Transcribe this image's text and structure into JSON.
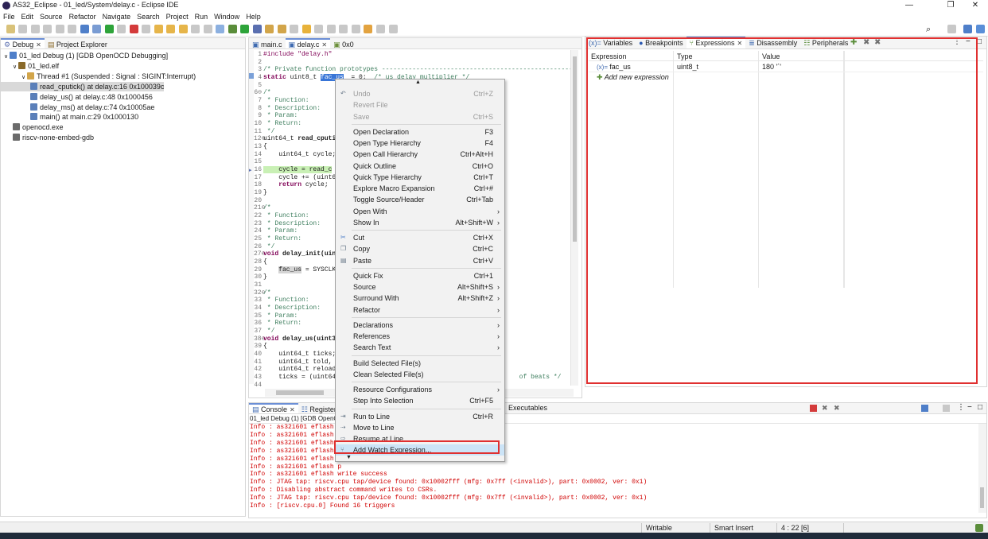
{
  "window": {
    "title": "AS32_Eclipse - 01_led/System/delay.c - Eclipse IDE",
    "minimize": "—",
    "maximize": "❐",
    "close": "✕"
  },
  "menubar": [
    "File",
    "Edit",
    "Source",
    "Refactor",
    "Navigate",
    "Search",
    "Project",
    "Run",
    "Window",
    "Help"
  ],
  "colors": {
    "accent": "#6b8fd6",
    "highlight_box": "#e03030",
    "console_text": "#d00000",
    "selection": "#cce4f7"
  },
  "debug_view": {
    "tabs": [
      "Debug",
      "Project Explorer"
    ],
    "items": [
      {
        "label": "01_led Debug (1) [GDB OpenOCD Debugging]",
        "icon": "launch-config-icon",
        "indent": 0
      },
      {
        "label": "01_led.elf",
        "icon": "elf-icon",
        "indent": 1
      },
      {
        "label": "Thread #1 (Suspended : Signal : SIGINT:Interrupt)",
        "icon": "thread-icon",
        "indent": 2
      },
      {
        "label": "read_cputick() at delay.c:16 0x100039c",
        "icon": "stack-frame-icon",
        "indent": 3,
        "selected": true
      },
      {
        "label": "delay_us() at delay.c:48 0x1000456",
        "icon": "stack-frame-icon",
        "indent": 3
      },
      {
        "label": "delay_ms() at delay.c:74 0x10005ae",
        "icon": "stack-frame-icon",
        "indent": 3
      },
      {
        "label": "main() at main.c:29 0x1000130",
        "icon": "stack-frame-icon",
        "indent": 3
      },
      {
        "label": "openocd.exe",
        "icon": "process-icon",
        "indent": 1
      },
      {
        "label": "riscv-none-embed-gdb",
        "icon": "process-icon",
        "indent": 1
      }
    ]
  },
  "editor": {
    "tabs": [
      "main.c",
      "delay.c",
      "0x0"
    ],
    "active_tab": "delay.c",
    "lines": [
      {
        "n": "1",
        "parts": [
          [
            "pp",
            "#include \"delay.h\""
          ]
        ]
      },
      {
        "n": "2",
        "parts": [
          [
            "",
            ""
          ]
        ]
      },
      {
        "n": "3",
        "parts": [
          [
            "cm",
            "/* Private function prototypes --------------------------------------------------*/"
          ]
        ]
      },
      {
        "n": "4",
        "parts": [
          [
            "kw",
            "static "
          ],
          [
            "",
            "uint8_t "
          ],
          [
            "sel",
            "fac_us"
          ],
          [
            "",
            "  = 0;  "
          ],
          [
            "cm",
            "/* us delay multiplier */"
          ]
        ]
      },
      {
        "n": "5",
        "parts": [
          [
            "",
            ""
          ]
        ]
      },
      {
        "n": "6⊖",
        "parts": [
          [
            "cm",
            "/*"
          ]
        ]
      },
      {
        "n": "7",
        "parts": [
          [
            "cm",
            " * Function:"
          ]
        ]
      },
      {
        "n": "8",
        "parts": [
          [
            "cm",
            " * Description:"
          ]
        ]
      },
      {
        "n": "9",
        "parts": [
          [
            "cm",
            " * Param:"
          ]
        ]
      },
      {
        "n": "10",
        "parts": [
          [
            "cm",
            " * Return:"
          ]
        ]
      },
      {
        "n": "11",
        "parts": [
          [
            "cm",
            " */"
          ]
        ]
      },
      {
        "n": "12⊖",
        "parts": [
          [
            "",
            "uint64_t "
          ],
          [
            "b",
            "read_cputi"
          ]
        ]
      },
      {
        "n": "13",
        "parts": [
          [
            "",
            "{"
          ]
        ]
      },
      {
        "n": "14",
        "parts": [
          [
            "",
            "    uint64_t cycle;"
          ]
        ]
      },
      {
        "n": "15",
        "parts": [
          [
            "",
            ""
          ]
        ]
      },
      {
        "n": "16",
        "parts": [
          [
            "cur",
            "    cycle = read_c"
          ]
        ]
      },
      {
        "n": "17",
        "parts": [
          [
            "",
            "    cycle += (uint6"
          ]
        ]
      },
      {
        "n": "18",
        "parts": [
          [
            "kw",
            "    return "
          ],
          [
            "",
            "cycle;"
          ]
        ]
      },
      {
        "n": "19",
        "parts": [
          [
            "",
            "}"
          ]
        ]
      },
      {
        "n": "20",
        "parts": [
          [
            "",
            ""
          ]
        ]
      },
      {
        "n": "21⊖",
        "parts": [
          [
            "cm",
            "/*"
          ]
        ]
      },
      {
        "n": "22",
        "parts": [
          [
            "cm",
            " * Function:"
          ]
        ]
      },
      {
        "n": "23",
        "parts": [
          [
            "cm",
            " * Description:"
          ]
        ]
      },
      {
        "n": "24",
        "parts": [
          [
            "cm",
            " * Param:"
          ]
        ]
      },
      {
        "n": "25",
        "parts": [
          [
            "cm",
            " * Return:"
          ]
        ]
      },
      {
        "n": "26",
        "parts": [
          [
            "cm",
            " */"
          ]
        ]
      },
      {
        "n": "27⊖",
        "parts": [
          [
            "kw",
            "void "
          ],
          [
            "b",
            "delay_init(uin"
          ]
        ]
      },
      {
        "n": "28",
        "parts": [
          [
            "",
            "{"
          ]
        ]
      },
      {
        "n": "29",
        "parts": [
          [
            "",
            "    "
          ],
          [
            "hl",
            "fac_us"
          ],
          [
            "",
            " = SYSCLK"
          ]
        ]
      },
      {
        "n": "30",
        "parts": [
          [
            "",
            "}"
          ]
        ]
      },
      {
        "n": "31",
        "parts": [
          [
            "",
            ""
          ]
        ]
      },
      {
        "n": "32⊖",
        "parts": [
          [
            "cm",
            "/*"
          ]
        ]
      },
      {
        "n": "33",
        "parts": [
          [
            "cm",
            " * Function:"
          ]
        ]
      },
      {
        "n": "34",
        "parts": [
          [
            "cm",
            " * Description:"
          ]
        ]
      },
      {
        "n": "35",
        "parts": [
          [
            "cm",
            " * Param:"
          ]
        ]
      },
      {
        "n": "36",
        "parts": [
          [
            "cm",
            " * Return:"
          ]
        ]
      },
      {
        "n": "37",
        "parts": [
          [
            "cm",
            " */"
          ]
        ]
      },
      {
        "n": "38⊖",
        "parts": [
          [
            "kw",
            "void "
          ],
          [
            "b",
            "delay_us(uint3"
          ]
        ]
      },
      {
        "n": "39",
        "parts": [
          [
            "",
            "{"
          ]
        ]
      },
      {
        "n": "40",
        "parts": [
          [
            "",
            "    uint64_t ticks;"
          ]
        ]
      },
      {
        "n": "41",
        "parts": [
          [
            "",
            "    uint64_t told,"
          ]
        ]
      },
      {
        "n": "42",
        "parts": [
          [
            "",
            "    uint64_t reload"
          ]
        ]
      },
      {
        "n": "43",
        "parts": [
          [
            "",
            "    ticks = (uint64"
          ],
          [
            "",
            "                                               "
          ],
          [
            "cm",
            " of beats */"
          ]
        ]
      },
      {
        "n": "44",
        "parts": [
          [
            "",
            ""
          ]
        ]
      }
    ]
  },
  "context_menu": {
    "items": [
      {
        "label": "Undo",
        "key": "Ctrl+Z",
        "disabled": true,
        "icon": "undo-icon"
      },
      {
        "label": "Revert File",
        "key": "",
        "disabled": true
      },
      {
        "label": "Save",
        "key": "Ctrl+S",
        "disabled": true
      },
      {
        "sep": true
      },
      {
        "label": "Open Declaration",
        "key": "F3"
      },
      {
        "label": "Open Type Hierarchy",
        "key": "F4"
      },
      {
        "label": "Open Call Hierarchy",
        "key": "Ctrl+Alt+H"
      },
      {
        "label": "Quick Outline",
        "key": "Ctrl+O"
      },
      {
        "label": "Quick Type Hierarchy",
        "key": "Ctrl+T"
      },
      {
        "label": "Explore Macro Expansion",
        "key": "Ctrl+#"
      },
      {
        "label": "Toggle Source/Header",
        "key": "Ctrl+Tab"
      },
      {
        "label": "Open With",
        "key": "",
        "arrow": true
      },
      {
        "label": "Show In",
        "key": "Alt+Shift+W",
        "arrow": true
      },
      {
        "sep": true
      },
      {
        "label": "Cut",
        "key": "Ctrl+X",
        "icon": "cut-icon"
      },
      {
        "label": "Copy",
        "key": "Ctrl+C",
        "icon": "copy-icon"
      },
      {
        "label": "Paste",
        "key": "Ctrl+V",
        "icon": "paste-icon"
      },
      {
        "sep": true
      },
      {
        "label": "Quick Fix",
        "key": "Ctrl+1"
      },
      {
        "label": "Source",
        "key": "Alt+Shift+S",
        "arrow": true
      },
      {
        "label": "Surround With",
        "key": "Alt+Shift+Z",
        "arrow": true
      },
      {
        "label": "Refactor",
        "key": "",
        "arrow": true
      },
      {
        "sep": true
      },
      {
        "label": "Declarations",
        "key": "",
        "arrow": true
      },
      {
        "label": "References",
        "key": "",
        "arrow": true
      },
      {
        "label": "Search Text",
        "key": "",
        "arrow": true
      },
      {
        "sep": true
      },
      {
        "label": "Build Selected File(s)",
        "key": ""
      },
      {
        "label": "Clean Selected File(s)",
        "key": ""
      },
      {
        "sep": true
      },
      {
        "label": "Resource Configurations",
        "key": "",
        "arrow": true
      },
      {
        "label": "Step Into Selection",
        "key": "Ctrl+F5"
      },
      {
        "sep": true
      },
      {
        "label": "Run to Line",
        "key": "Ctrl+R",
        "icon": "run-to-line-icon"
      },
      {
        "label": "Move to Line",
        "key": "",
        "icon": "move-to-line-icon"
      },
      {
        "label": "Resume at Line",
        "key": "",
        "icon": "resume-at-line-icon"
      },
      {
        "label": "Add Watch Expression...",
        "key": "",
        "icon": "watch-expression-icon",
        "highlighted": true
      }
    ]
  },
  "expressions_view": {
    "tabs": [
      "Variables",
      "Breakpoints",
      "Expressions",
      "Disassembly",
      "Peripherals"
    ],
    "active_tab": "Expressions",
    "columns": [
      "Expression",
      "Type",
      "Value"
    ],
    "rows": [
      {
        "expression": "fac_us",
        "type": "uint8_t",
        "value": "180 '´'"
      }
    ],
    "add_new": "Add new expression"
  },
  "console": {
    "tabs": [
      "Console",
      "Registers"
    ],
    "extra_tab": "Executables",
    "launch": "01_led Debug (1) [GDB OpenOCD Debugging] openocd.exe",
    "lines": [
      "Info : as32i601 eflash p",
      "Info : as32i601 eflash p",
      "Info : as32i601 eflash p",
      "Info : as32i601 eflash p",
      "Info : as32i601 eflash p",
      "Info : as32i601 eflash p",
      "Info : as32i601 eflash write success",
      "Info : JTAG tap: riscv.cpu tap/device found: 0x10002fff (mfg: 0x7ff (<invalid>), part: 0x0002, ver: 0x1)",
      "Info : Disabling abstract command writes to CSRs.",
      "Info : JTAG tap: riscv.cpu tap/device found: 0x10002fff (mfg: 0x7ff (<invalid>), part: 0x0002, ver: 0x1)",
      "Info : [riscv.cpu.0] Found 16 triggers"
    ]
  },
  "statusbar": {
    "mode": "Writable",
    "insert": "Smart Insert",
    "position": "4 : 22 [6]"
  }
}
